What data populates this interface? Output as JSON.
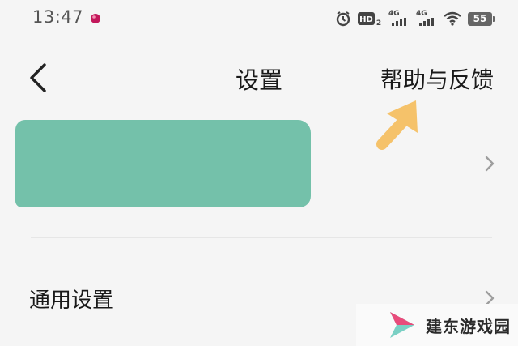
{
  "status_bar": {
    "time": "13:47",
    "hd_label": "HD",
    "hd_sub": "2",
    "network_1": "4G",
    "network_2": "4G",
    "battery": "55"
  },
  "nav": {
    "title": "设置",
    "help_link": "帮助与反馈"
  },
  "list": {
    "general_settings": "通用设置"
  },
  "watermark": {
    "text": "建东游戏园"
  },
  "colors": {
    "account_block": "#74c1aa",
    "arrow": "#f5c26a",
    "background": "#f5f5f5"
  }
}
